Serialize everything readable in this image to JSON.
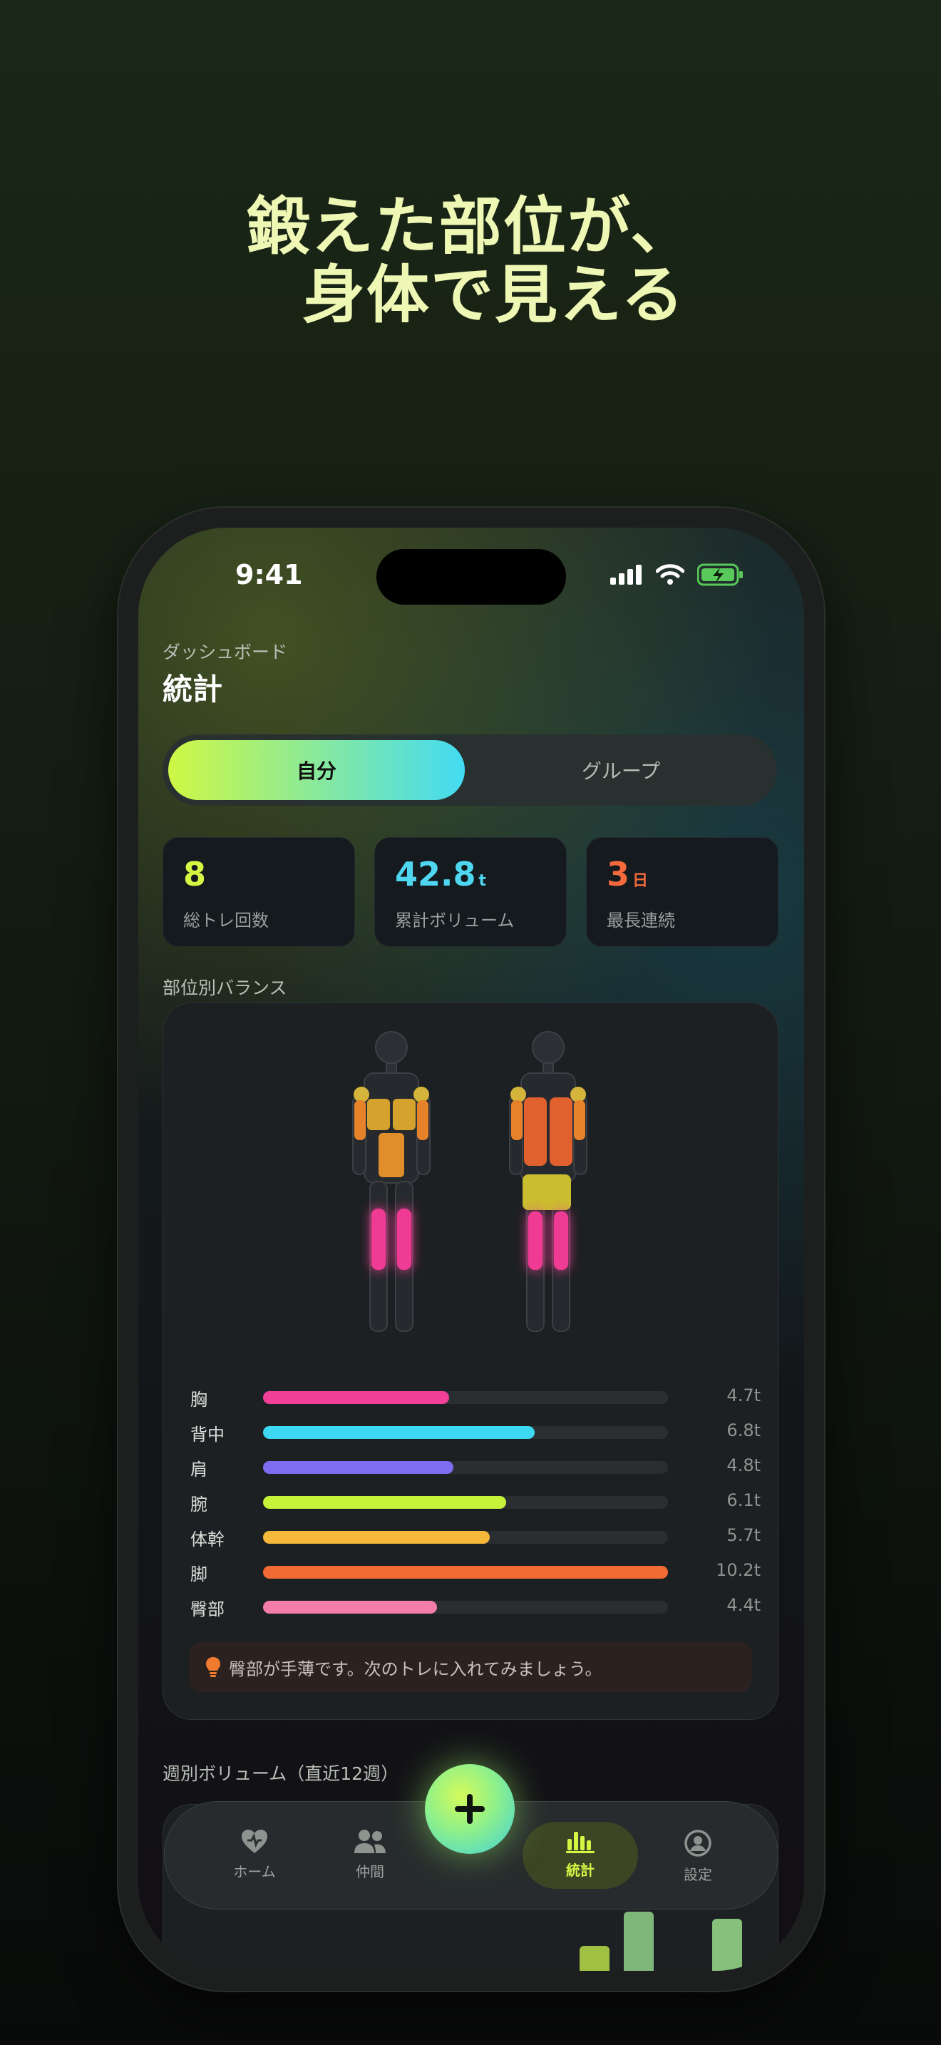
{
  "headline": {
    "line1": "鍛えた部位が、",
    "line2": "  身体で見える"
  },
  "status_bar": {
    "time": "9:41"
  },
  "header": {
    "subtitle": "ダッシュボード",
    "title": "統計"
  },
  "segmented": {
    "options": [
      "自分",
      "グループ"
    ],
    "selected": "自分"
  },
  "stats": [
    {
      "value": "8",
      "unit": "",
      "label": "総トレ回数",
      "color": "#d6f545"
    },
    {
      "value": "42.8",
      "unit": "t",
      "label": "累計ボリューム",
      "color": "#4fd6f0"
    },
    {
      "value": "3",
      "unit": "日",
      "label": "最長連続",
      "color": "#f46a3c"
    }
  ],
  "balance": {
    "title": "部位別バランス",
    "bars": [
      {
        "name": "胸",
        "value": "4.7t",
        "fraction": 0.46,
        "color": "#f23f97"
      },
      {
        "name": "背中",
        "value": "6.8t",
        "fraction": 0.67,
        "color": "#3dd8f2"
      },
      {
        "name": "肩",
        "value": "4.8t",
        "fraction": 0.47,
        "color": "#7f6cf0"
      },
      {
        "name": "腕",
        "value": "6.1t",
        "fraction": 0.6,
        "color": "#c6f23a"
      },
      {
        "name": "体幹",
        "value": "5.7t",
        "fraction": 0.56,
        "color": "#f5b83a"
      },
      {
        "name": "脚",
        "value": "10.2t",
        "fraction": 1.0,
        "color": "#f26a34"
      },
      {
        "name": "臀部",
        "value": "4.4t",
        "fraction": 0.43,
        "color": "#f27ea8"
      }
    ],
    "tip": "臀部が手薄です。次のトレに入れてみましょう。"
  },
  "weekly": {
    "title": "週別ボリューム（直近12週）"
  },
  "tabbar": {
    "items": [
      {
        "label": "ホーム",
        "icon": "heart-pulse-icon"
      },
      {
        "label": "仲間",
        "icon": "people-icon"
      },
      {
        "label": "統計",
        "icon": "bar-chart-icon",
        "active": true
      },
      {
        "label": "設定",
        "icon": "person-circle-icon"
      }
    ],
    "fab_icon": "plus-icon"
  }
}
